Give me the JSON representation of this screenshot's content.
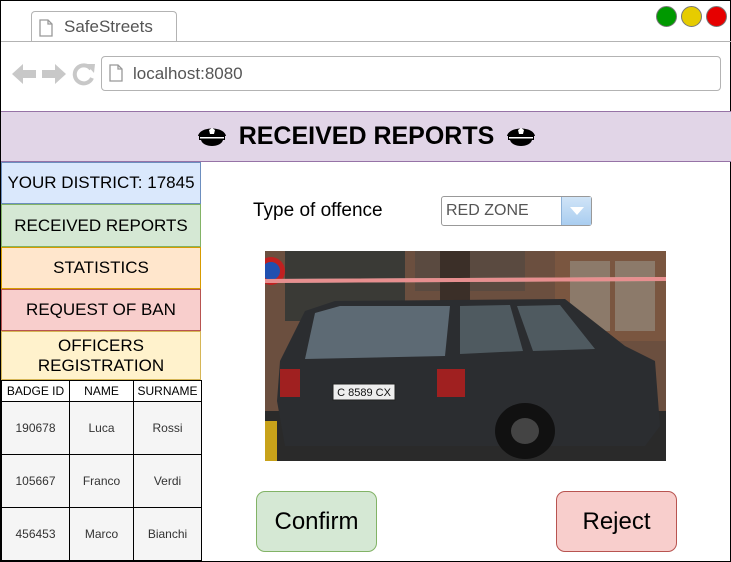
{
  "browser": {
    "tab_title": "SafeStreets",
    "url": "localhost:8080",
    "window_buttons": {
      "green": "#009900",
      "yellow": "#e6cc00",
      "red": "#e60000"
    }
  },
  "header": {
    "title": "RECEIVED REPORTS",
    "icon": "police-cap-icon",
    "bg_color": "#e1d5e7"
  },
  "sidebar": {
    "district": "YOUR DISTRICT: 17845",
    "received_reports": "RECEIVED REPORTS",
    "statistics": "STATISTICS",
    "request_of_ban": "REQUEST OF BAN",
    "officers_registration": "OFFICERS REGISTRATION"
  },
  "officers_table": {
    "headers": [
      "BADGE ID",
      "NAME",
      "SURNAME"
    ],
    "rows": [
      [
        "190678",
        "Luca",
        "Rossi"
      ],
      [
        "105667",
        "Franco",
        "Verdi"
      ],
      [
        "456453",
        "Marco",
        "Bianchi"
      ]
    ]
  },
  "report": {
    "offence_label": "Type of offence",
    "offence_value": "RED ZONE",
    "photo_plate": "C 8589 CX",
    "confirm_label": "Confirm",
    "reject_label": "Reject"
  }
}
